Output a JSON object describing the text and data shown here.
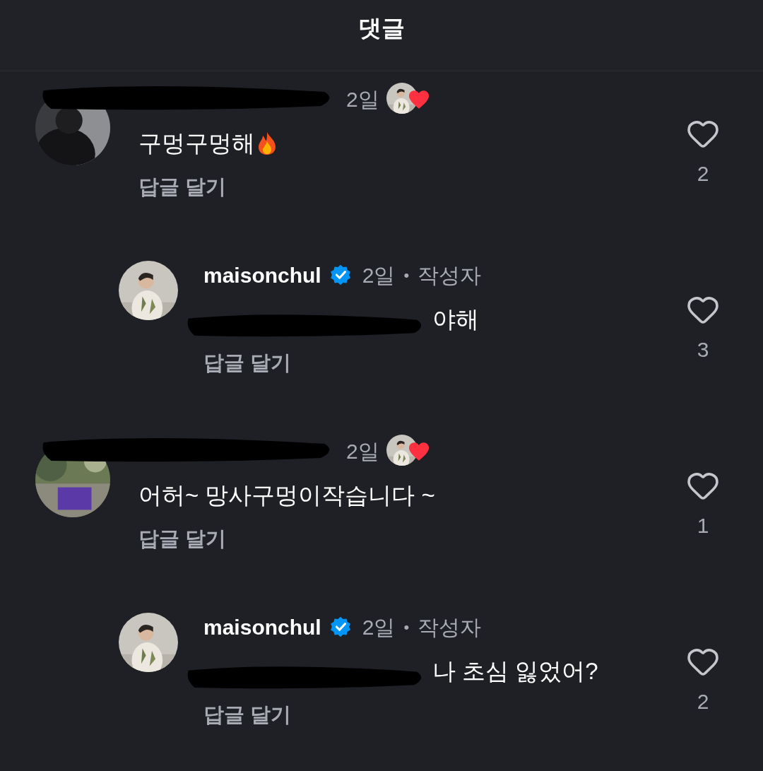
{
  "header": {
    "title": "댓글"
  },
  "comments": [
    {
      "redacted": true,
      "time": "2일",
      "liked_by_author": true,
      "text": "구멍구멍해",
      "fire": true,
      "reply_link": "답글 달기",
      "likes": "2",
      "replies": [
        {
          "redacted": false,
          "username": "maisonchul",
          "verified": true,
          "time": "2일",
          "separator": "•",
          "author_tag": "작성자",
          "mention_redacted": true,
          "text": "야해",
          "reply_link": "답글 달기",
          "likes": "3"
        }
      ]
    },
    {
      "redacted": true,
      "time": "2일",
      "liked_by_author": true,
      "text": "어허~ 망사구멍이작습니다 ~",
      "reply_link": "답글 달기",
      "likes": "1",
      "replies": [
        {
          "redacted": false,
          "username": "maisonchul",
          "verified": true,
          "time": "2일",
          "separator": "•",
          "author_tag": "작성자",
          "mention_redacted": true,
          "text": "나 초심 잃었어?",
          "reply_link": "답글 달기",
          "likes": "2"
        }
      ]
    }
  ]
}
